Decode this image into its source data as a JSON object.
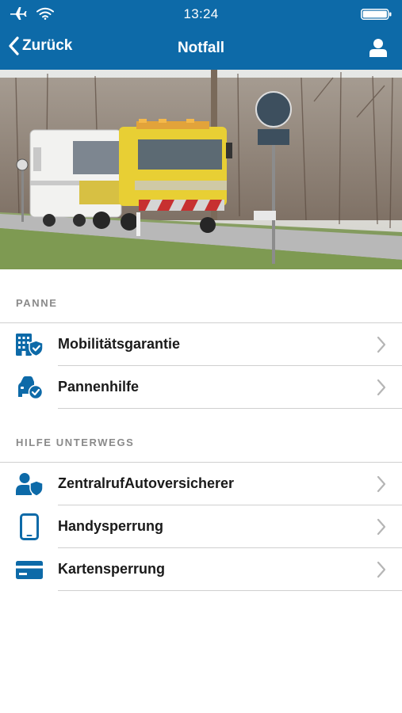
{
  "status_bar": {
    "time": "13:24",
    "icons": [
      "airplane-icon",
      "wifi-icon",
      "battery-icon"
    ]
  },
  "nav": {
    "back_label": "Zurück",
    "title": "Notfall",
    "icons": [
      "chevron-left-icon",
      "profile-icon"
    ]
  },
  "hero": {
    "alt": "tow-truck-with-caravan-photo"
  },
  "sections": [
    {
      "header": "PANNE",
      "items": [
        {
          "label": "Mobilitätsgarantie",
          "icon": "building-shield-icon"
        },
        {
          "label": "Pannenhilfe",
          "icon": "car-check-icon"
        }
      ]
    },
    {
      "header": "HILFE UNTERWEGS",
      "items": [
        {
          "label": "ZentralrufAutoversicherer",
          "icon": "person-shield-icon"
        },
        {
          "label": "Handysperrung",
          "icon": "phone-icon"
        },
        {
          "label": "Kartensperrung",
          "icon": "card-icon"
        }
      ]
    }
  ],
  "colors": {
    "brand": "#0d6aa8",
    "separator": "#cfcfcf",
    "section_header": "#8a8a8a",
    "chevron": "#b5b5b5"
  }
}
